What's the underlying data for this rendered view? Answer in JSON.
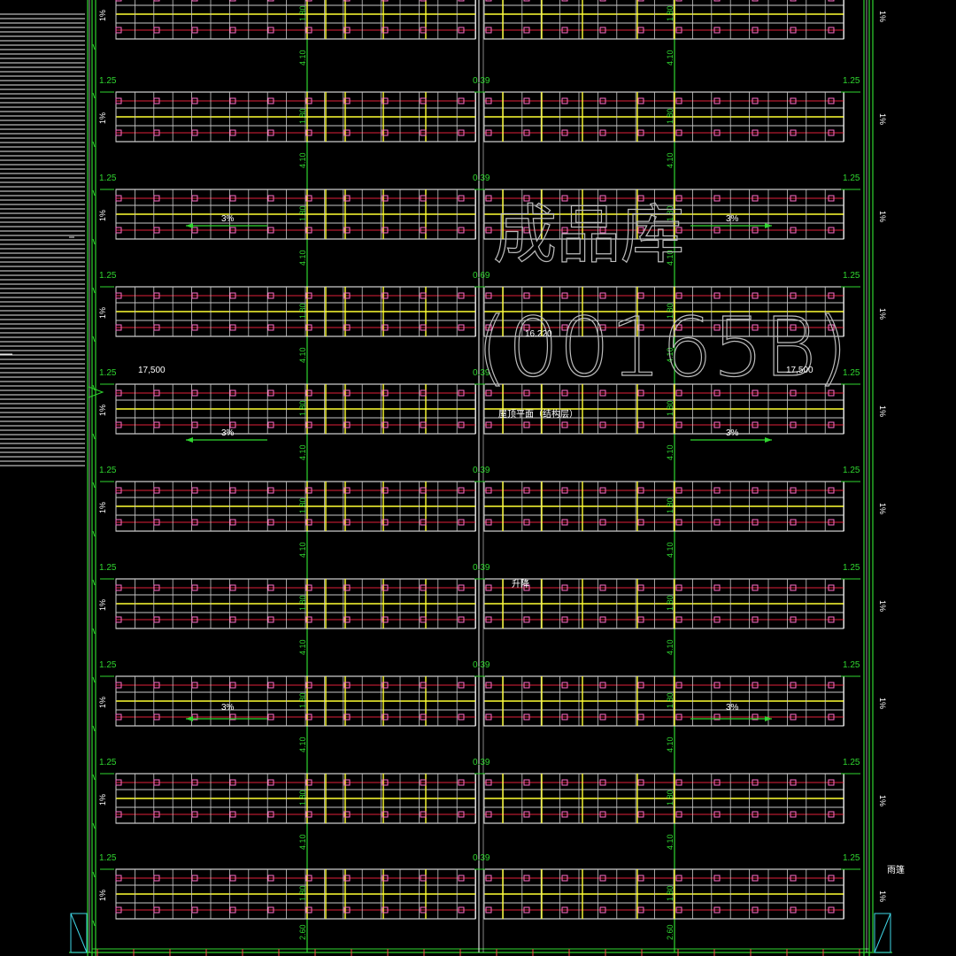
{
  "drawing": {
    "title": "屋顶平面（结构层）",
    "watermark_name": "成品库",
    "watermark_code": "(00165B)",
    "level": "16.220",
    "extent_label": "17,500",
    "slope_main": "3%",
    "slope_edge": "1%",
    "row_gap": "4.10",
    "row_width": "1.80",
    "bottom_gap": "2.60",
    "edge_offset": "1.25",
    "center_offset": "0.39",
    "center_offset_alt": "0.69",
    "note_center": "升降",
    "note_right": "雨篷"
  },
  "colors": {
    "background": "#000000",
    "frame": "#2fd62f",
    "panel": "#ffffff",
    "panel_line": "#c8c8c8",
    "yellow": "#ffff33",
    "red": "#e0203a",
    "cyan": "#3fd6e6",
    "pink": "#ff6ec7",
    "watermark": "#bcbcbc"
  },
  "layout_info": {
    "row_count": 10
  }
}
